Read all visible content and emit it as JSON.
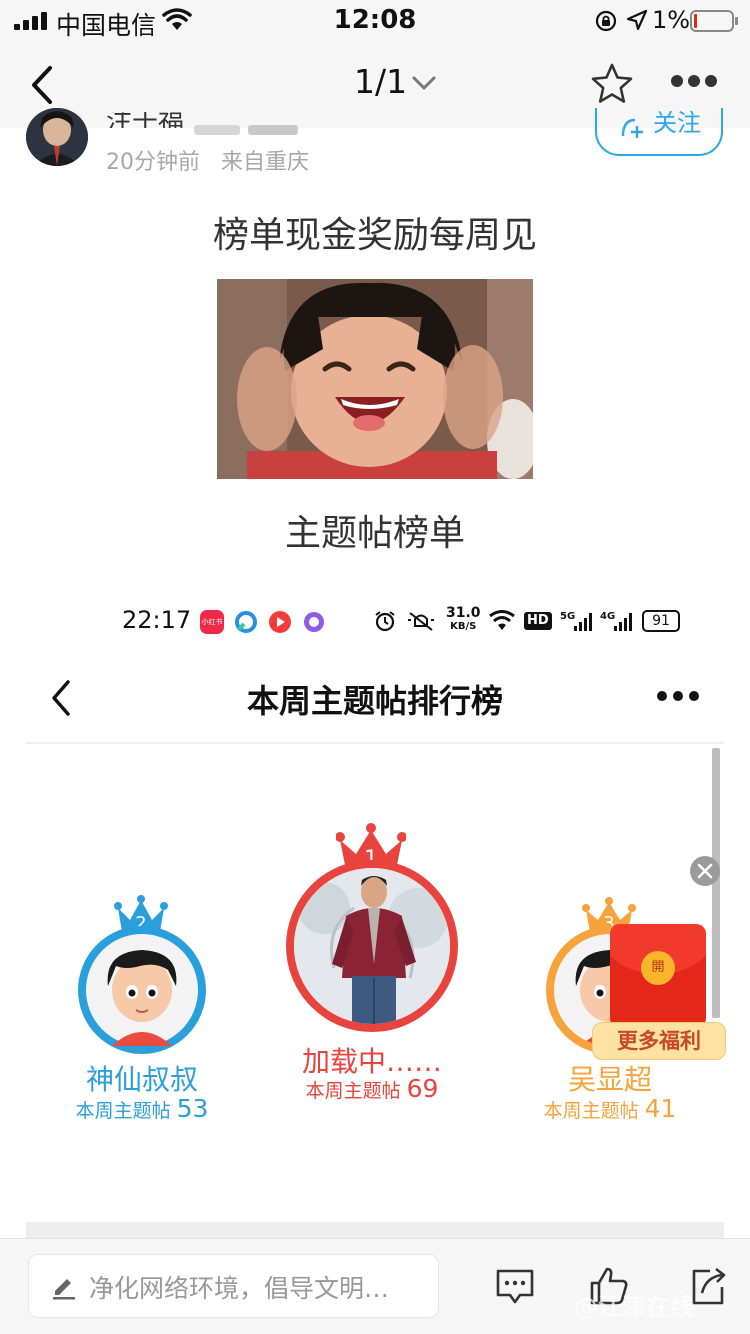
{
  "status_bar": {
    "carrier": "中国电信",
    "time": "12:08",
    "battery": "1%"
  },
  "nav": {
    "page_indicator": "1/1"
  },
  "post": {
    "author_name": "注于福",
    "time_ago": "20分钟前",
    "location": "来自重庆",
    "follow_label": "关注",
    "title": "榜单现金奖励每周见",
    "subtitle": "主题帖榜单"
  },
  "embedded": {
    "status_time": "22:17",
    "net_speed": "31.0",
    "net_unit": "KB/S",
    "hd_badge": "HD",
    "sig_5g": "5G",
    "sig_4g": "4G",
    "battery": "91",
    "app_badge": "小红书",
    "page_title": "本周主题帖排行榜",
    "ranking": [
      {
        "rank": "1",
        "name": "加载中……",
        "count_label": "本周主题帖",
        "count": "69",
        "color": "#e8443d"
      },
      {
        "rank": "2",
        "name": "神仙叔叔",
        "count_label": "本周主题帖",
        "count": "53",
        "color": "#2a9fdb"
      },
      {
        "rank": "3",
        "name": "吴显超",
        "count_label": "本周主题帖",
        "count": "41",
        "color": "#f5a33a"
      }
    ],
    "redpack_seal": "開",
    "welfare_label": "更多福利"
  },
  "bottom_bar": {
    "comment_placeholder": "净化网络环境，倡导文明…",
    "watermark": "@江津在线"
  },
  "colors": {
    "accent_blue": "#2ea7e8",
    "rank1": "#e8443d",
    "rank2": "#2a9fdb",
    "rank3": "#f5a33a"
  }
}
